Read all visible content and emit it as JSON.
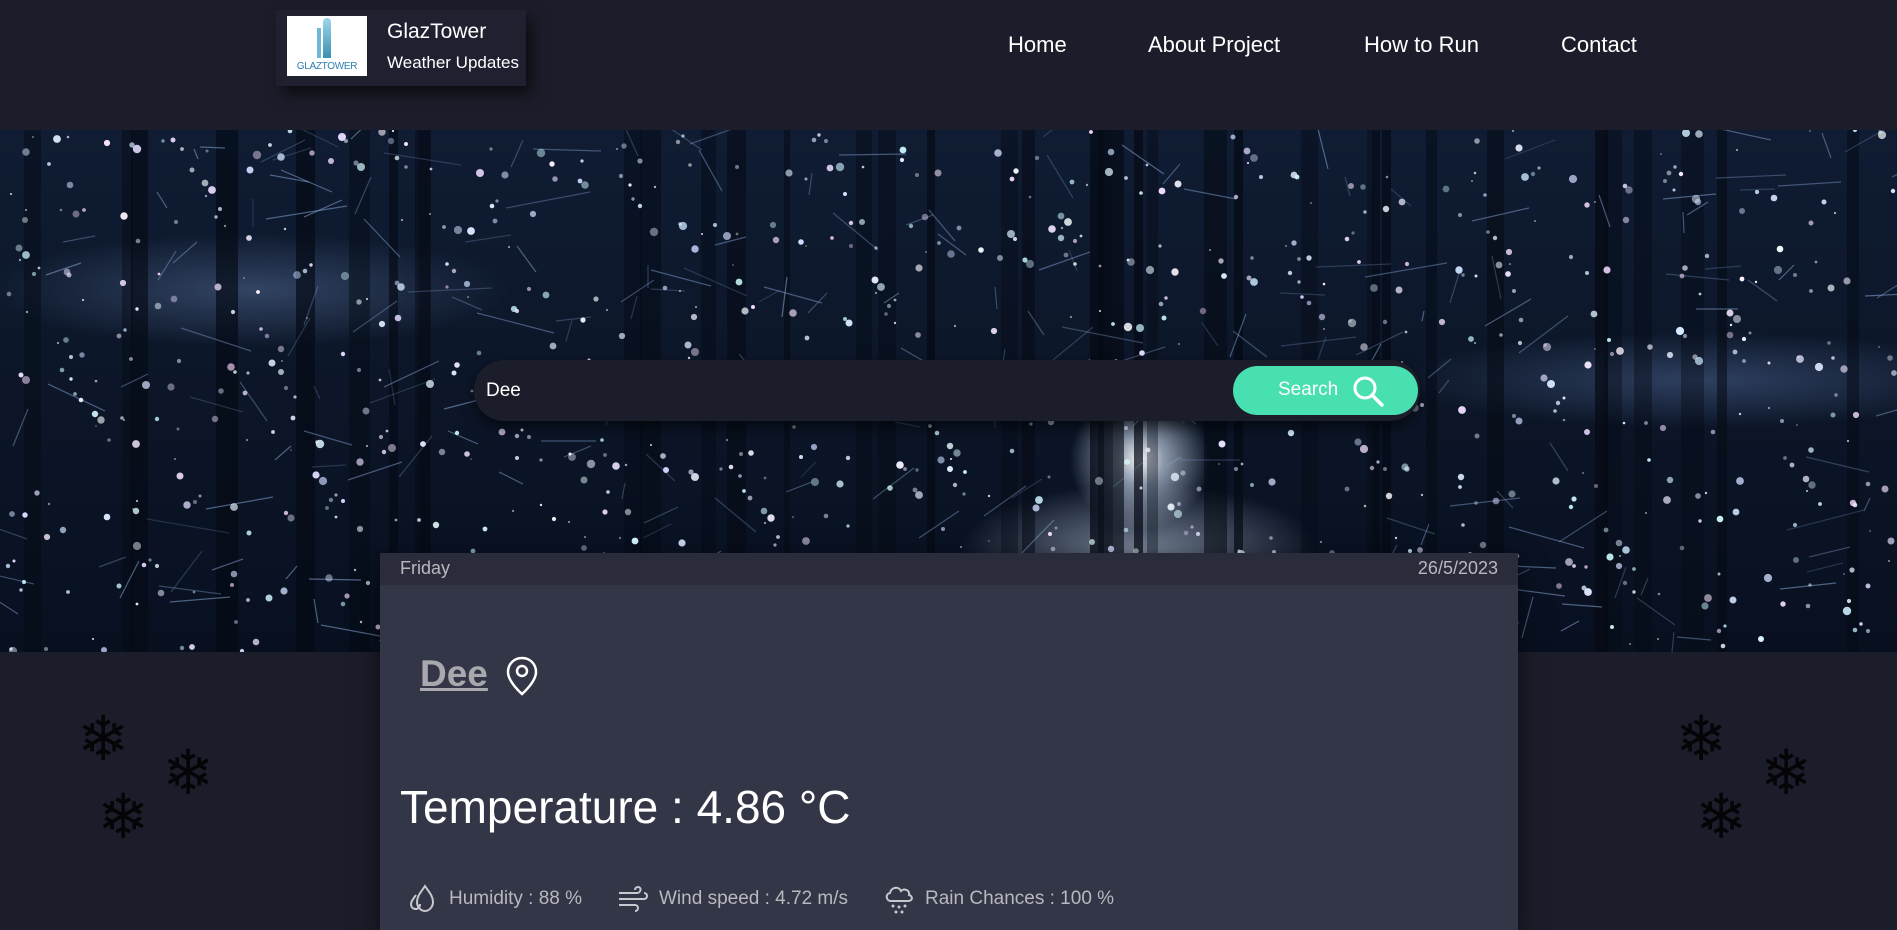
{
  "brand": {
    "title": "GlazTower",
    "subtitle": "Weather Updates",
    "logo_text": "GLAZTOWER"
  },
  "nav": {
    "items": [
      "Home",
      "About Project",
      "How to Run",
      "Contact"
    ]
  },
  "search": {
    "value": "Dee",
    "button_label": "Search"
  },
  "weather": {
    "day": "Friday",
    "date": "26/5/2023",
    "city": "Dee",
    "temperature": "Temperature : 4.86 °C",
    "humidity": "Humidity : 88 %",
    "wind": "Wind speed : 4.72 m/s",
    "rain": "Rain Chances : 100 %"
  },
  "colors": {
    "accent": "#48e0b0",
    "background": "#1c1d2a",
    "card": "#333646"
  },
  "icons": [
    "search-icon",
    "location-pin-icon",
    "humidity-icon",
    "wind-icon",
    "rain-cloud-icon",
    "snowflake-icon"
  ]
}
